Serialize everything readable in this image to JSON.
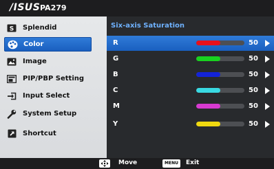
{
  "header": {
    "brand": "/ISUS",
    "model": "PA279"
  },
  "menu": {
    "items": [
      {
        "label": "Splendid",
        "icon": "splendid-icon",
        "active": false
      },
      {
        "label": "Color",
        "icon": "palette-icon",
        "active": true
      },
      {
        "label": "Image",
        "icon": "image-icon",
        "active": false
      },
      {
        "label": "PIP/PBP Setting",
        "icon": "pip-pbp-icon",
        "active": false
      },
      {
        "label": "Input Select",
        "icon": "input-select-icon",
        "active": false
      },
      {
        "label": "System Setup",
        "icon": "wrench-icon",
        "active": false
      },
      {
        "label": "Shortcut",
        "icon": "shortcut-icon",
        "active": false
      }
    ]
  },
  "panel": {
    "title": "Six-axis Saturation",
    "rows": [
      {
        "label": "R",
        "value": "50",
        "level": 0.5,
        "color": "#e8101c",
        "selected": true
      },
      {
        "label": "G",
        "value": "50",
        "level": 0.5,
        "color": "#18d21f",
        "selected": false
      },
      {
        "label": "B",
        "value": "50",
        "level": 0.5,
        "color": "#1323d8",
        "selected": false
      },
      {
        "label": "C",
        "value": "50",
        "level": 0.5,
        "color": "#39d9e2",
        "selected": false
      },
      {
        "label": "M",
        "value": "50",
        "level": 0.5,
        "color": "#d83ad1",
        "selected": false
      },
      {
        "label": "Y",
        "value": "50",
        "level": 0.5,
        "color": "#f0d910",
        "selected": false
      }
    ]
  },
  "footer": {
    "move_label": "Move",
    "menu_key_label": "MENU",
    "exit_label": "Exit",
    "move_icon": "joystick-icon"
  },
  "colors": {
    "accent": "#1a5fbf",
    "title_blue": "#6fb2ff",
    "panel_bg": "#282a2d",
    "menu_bg": "#dfe1e4"
  }
}
